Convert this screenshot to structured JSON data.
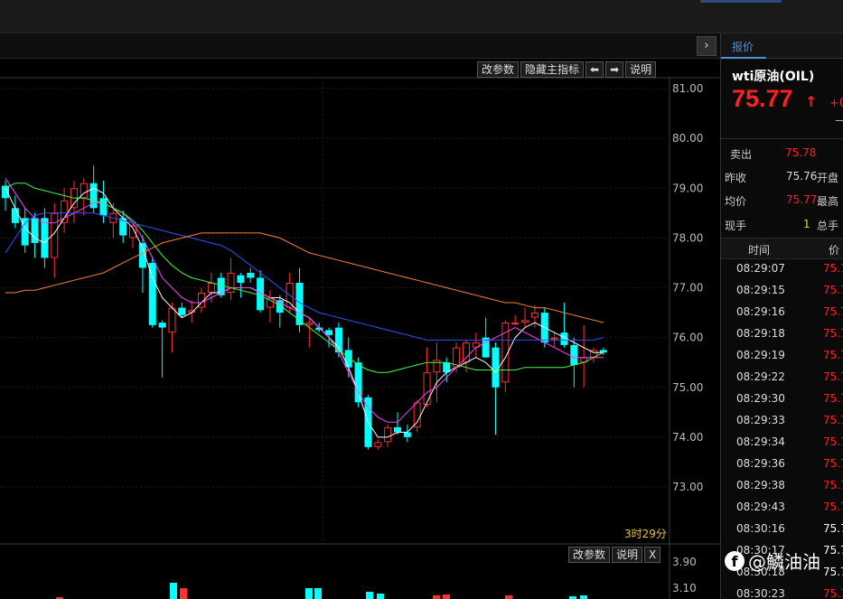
{
  "toolbar": {
    "change_params": "改参数",
    "hide_main_indicator": "隐藏主指标",
    "left_arrow": "⬅",
    "right_arrow": "➡",
    "explain": "说明",
    "collapse_icon": "›"
  },
  "volume_toolbar": {
    "change_params": "改参数",
    "explain": "说明",
    "close": "X"
  },
  "chart_data": {
    "type": "candlestick",
    "ylim": [
      72.0,
      81.2
    ],
    "y_ticks": [
      "81.00",
      "80.00",
      "79.00",
      "78.00",
      "77.00",
      "76.00",
      "75.00",
      "74.00",
      "73.00"
    ],
    "candles": [
      {
        "o": 79.05,
        "h": 79.15,
        "l": 78.55,
        "c": 78.8
      },
      {
        "o": 78.6,
        "h": 78.85,
        "l": 78.2,
        "c": 78.3
      },
      {
        "o": 78.4,
        "h": 78.6,
        "l": 77.7,
        "c": 77.85
      },
      {
        "o": 78.4,
        "h": 78.5,
        "l": 77.6,
        "c": 77.9
      },
      {
        "o": 78.4,
        "h": 78.6,
        "l": 77.4,
        "c": 77.6
      },
      {
        "o": 77.6,
        "h": 78.7,
        "l": 77.2,
        "c": 78.5
      },
      {
        "o": 78.3,
        "h": 79.0,
        "l": 78.1,
        "c": 78.75
      },
      {
        "o": 78.6,
        "h": 79.15,
        "l": 78.3,
        "c": 79.0
      },
      {
        "o": 78.8,
        "h": 79.2,
        "l": 78.45,
        "c": 79.1
      },
      {
        "o": 79.1,
        "h": 79.45,
        "l": 78.5,
        "c": 78.6
      },
      {
        "o": 78.8,
        "h": 79.15,
        "l": 78.3,
        "c": 78.45
      },
      {
        "o": 78.3,
        "h": 78.7,
        "l": 78.0,
        "c": 78.5
      },
      {
        "o": 78.4,
        "h": 78.55,
        "l": 77.9,
        "c": 78.05
      },
      {
        "o": 78.0,
        "h": 78.3,
        "l": 77.8,
        "c": 78.25
      },
      {
        "o": 77.9,
        "h": 78.05,
        "l": 76.9,
        "c": 77.4
      },
      {
        "o": 77.5,
        "h": 77.6,
        "l": 76.2,
        "c": 76.25
      },
      {
        "o": 76.3,
        "h": 76.35,
        "l": 75.2,
        "c": 76.2
      },
      {
        "o": 76.1,
        "h": 76.7,
        "l": 75.7,
        "c": 76.6
      },
      {
        "o": 76.6,
        "h": 76.7,
        "l": 76.4,
        "c": 76.45
      },
      {
        "o": 76.5,
        "h": 76.75,
        "l": 76.3,
        "c": 76.55
      },
      {
        "o": 76.6,
        "h": 77.0,
        "l": 76.5,
        "c": 76.9
      },
      {
        "o": 76.9,
        "h": 77.3,
        "l": 76.7,
        "c": 77.1
      },
      {
        "o": 77.2,
        "h": 77.3,
        "l": 76.8,
        "c": 76.85
      },
      {
        "o": 76.9,
        "h": 77.6,
        "l": 76.75,
        "c": 77.3
      },
      {
        "o": 77.25,
        "h": 77.3,
        "l": 76.8,
        "c": 77.1
      },
      {
        "o": 77.3,
        "h": 77.4,
        "l": 77.1,
        "c": 77.2
      },
      {
        "o": 77.2,
        "h": 77.35,
        "l": 76.5,
        "c": 76.55
      },
      {
        "o": 76.6,
        "h": 76.95,
        "l": 76.3,
        "c": 76.8
      },
      {
        "o": 76.75,
        "h": 76.85,
        "l": 76.2,
        "c": 76.5
      },
      {
        "o": 76.6,
        "h": 77.3,
        "l": 76.5,
        "c": 77.1
      },
      {
        "o": 77.1,
        "h": 77.4,
        "l": 76.1,
        "c": 76.25
      },
      {
        "o": 76.25,
        "h": 76.4,
        "l": 75.8,
        "c": 76.3
      },
      {
        "o": 76.2,
        "h": 76.3,
        "l": 76.1,
        "c": 76.15
      },
      {
        "o": 76.15,
        "h": 76.2,
        "l": 75.8,
        "c": 76.05
      },
      {
        "o": 76.2,
        "h": 76.3,
        "l": 75.6,
        "c": 75.7
      },
      {
        "o": 75.75,
        "h": 76.0,
        "l": 75.2,
        "c": 75.4
      },
      {
        "o": 75.5,
        "h": 75.6,
        "l": 74.6,
        "c": 74.7
      },
      {
        "o": 74.8,
        "h": 74.85,
        "l": 73.75,
        "c": 73.8
      },
      {
        "o": 73.8,
        "h": 73.95,
        "l": 73.75,
        "c": 73.9
      },
      {
        "o": 73.9,
        "h": 74.25,
        "l": 73.8,
        "c": 74.2
      },
      {
        "o": 74.2,
        "h": 74.5,
        "l": 74.05,
        "c": 74.1
      },
      {
        "o": 74.1,
        "h": 74.25,
        "l": 73.9,
        "c": 74.0
      },
      {
        "o": 74.2,
        "h": 74.75,
        "l": 74.1,
        "c": 74.7
      },
      {
        "o": 74.65,
        "h": 75.8,
        "l": 74.6,
        "c": 75.3
      },
      {
        "o": 75.3,
        "h": 75.9,
        "l": 74.7,
        "c": 75.55
      },
      {
        "o": 75.5,
        "h": 75.6,
        "l": 75.1,
        "c": 75.3
      },
      {
        "o": 75.4,
        "h": 75.9,
        "l": 75.3,
        "c": 75.8
      },
      {
        "o": 75.5,
        "h": 75.95,
        "l": 75.3,
        "c": 75.9
      },
      {
        "o": 75.8,
        "h": 76.1,
        "l": 75.6,
        "c": 75.9
      },
      {
        "o": 76.0,
        "h": 76.4,
        "l": 75.6,
        "c": 75.6
      },
      {
        "o": 75.8,
        "h": 75.9,
        "l": 74.05,
        "c": 75.0
      },
      {
        "o": 75.1,
        "h": 76.35,
        "l": 74.9,
        "c": 76.3
      },
      {
        "o": 76.3,
        "h": 76.45,
        "l": 76.25,
        "c": 76.3
      },
      {
        "o": 76.3,
        "h": 76.6,
        "l": 76.2,
        "c": 76.35
      },
      {
        "o": 76.4,
        "h": 76.65,
        "l": 76.2,
        "c": 76.5
      },
      {
        "o": 76.5,
        "h": 76.6,
        "l": 75.8,
        "c": 75.9
      },
      {
        "o": 76.0,
        "h": 76.1,
        "l": 75.8,
        "c": 76.0
      },
      {
        "o": 76.1,
        "h": 76.7,
        "l": 75.8,
        "c": 75.85
      },
      {
        "o": 75.85,
        "h": 76.0,
        "l": 75.0,
        "c": 75.45
      },
      {
        "o": 75.5,
        "h": 76.25,
        "l": 75.0,
        "c": 75.6
      },
      {
        "o": 75.6,
        "h": 75.8,
        "l": 75.5,
        "c": 75.75
      },
      {
        "o": 75.75,
        "h": 75.8,
        "l": 75.65,
        "c": 75.7
      }
    ],
    "lines": [
      {
        "name": "",
        "color": "#ffffff",
        "points": [
          79.0,
          78.6,
          78.2,
          78.0,
          77.9,
          78.1,
          78.4,
          78.7,
          78.9,
          79.0,
          78.9,
          78.6,
          78.4,
          78.2,
          77.8,
          77.2,
          76.8,
          76.6,
          76.4,
          76.5,
          76.7,
          76.9,
          76.9,
          77.0,
          77.0,
          77.0,
          76.9,
          76.8,
          76.8,
          76.7,
          76.5,
          76.4,
          76.2,
          76.0,
          75.8,
          75.4,
          74.9,
          74.3,
          74.0,
          74.0,
          74.1,
          74.1,
          74.3,
          74.7,
          75.1,
          75.3,
          75.4,
          75.5,
          75.6,
          75.5,
          75.3,
          75.6,
          76.0,
          76.2,
          76.3,
          76.2,
          76.1,
          76.0,
          75.9,
          75.8,
          75.7,
          75.7
        ]
      },
      {
        "name": "",
        "color": "#ff40ff",
        "points": [
          79.2,
          78.9,
          78.6,
          78.4,
          78.3,
          78.3,
          78.4,
          78.5,
          78.6,
          78.7,
          78.7,
          78.6,
          78.5,
          78.3,
          78.0,
          77.6,
          77.2,
          77.0,
          76.8,
          76.7,
          76.7,
          76.8,
          76.9,
          77.0,
          77.0,
          77.0,
          76.9,
          76.8,
          76.7,
          76.6,
          76.5,
          76.4,
          76.2,
          76.0,
          75.7,
          75.3,
          74.9,
          74.6,
          74.4,
          74.3,
          74.3,
          74.5,
          74.7,
          74.9,
          75.0,
          75.2,
          75.4,
          75.6,
          75.8,
          75.9,
          76.0,
          76.1,
          76.2,
          76.1,
          76.0,
          75.9,
          75.8,
          75.7,
          75.6,
          75.6,
          75.6,
          75.6
        ]
      },
      {
        "name": "",
        "color": "#40ff40",
        "points": [
          79.0,
          79.1,
          79.1,
          79.0,
          78.95,
          78.9,
          78.85,
          78.8,
          78.8,
          78.75,
          78.7,
          78.6,
          78.5,
          78.35,
          78.15,
          77.9,
          77.65,
          77.45,
          77.3,
          77.2,
          77.15,
          77.1,
          77.05,
          77.0,
          76.95,
          76.9,
          76.85,
          76.75,
          76.65,
          76.5,
          76.35,
          76.2,
          76.05,
          75.9,
          75.75,
          75.6,
          75.45,
          75.35,
          75.3,
          75.3,
          75.35,
          75.4,
          75.45,
          75.5,
          75.5,
          75.5,
          75.45,
          75.4,
          75.35,
          75.35,
          75.35,
          75.35,
          75.35,
          75.4,
          75.4,
          75.4,
          75.4,
          75.4,
          75.45,
          75.5,
          75.6,
          75.7
        ]
      },
      {
        "name": "",
        "color": "#3050ff",
        "points": [
          77.7,
          78.0,
          78.3,
          78.45,
          78.5,
          78.5,
          78.5,
          78.5,
          78.5,
          78.5,
          78.45,
          78.4,
          78.35,
          78.3,
          78.25,
          78.2,
          78.15,
          78.1,
          78.05,
          78.0,
          77.95,
          77.9,
          77.85,
          77.75,
          77.6,
          77.45,
          77.3,
          77.15,
          77.0,
          76.85,
          76.7,
          76.6,
          76.5,
          76.45,
          76.4,
          76.35,
          76.3,
          76.25,
          76.2,
          76.15,
          76.1,
          76.05,
          76.0,
          75.95,
          75.95,
          75.95,
          75.95,
          75.95,
          75.95,
          75.95,
          75.95,
          75.95,
          75.95,
          75.95,
          75.95,
          75.95,
          75.95,
          75.95,
          75.95,
          75.95,
          75.95,
          76.0
        ]
      },
      {
        "name": "",
        "color": "#ff8030",
        "points": [
          76.9,
          76.9,
          76.95,
          76.95,
          77.0,
          77.05,
          77.1,
          77.15,
          77.2,
          77.25,
          77.3,
          77.4,
          77.5,
          77.6,
          77.7,
          77.8,
          77.9,
          77.95,
          78.0,
          78.05,
          78.1,
          78.1,
          78.1,
          78.1,
          78.1,
          78.1,
          78.1,
          78.05,
          78.0,
          77.9,
          77.8,
          77.7,
          77.65,
          77.6,
          77.55,
          77.5,
          77.45,
          77.4,
          77.35,
          77.3,
          77.25,
          77.2,
          77.15,
          77.1,
          77.05,
          77.0,
          76.95,
          76.9,
          76.85,
          76.8,
          76.75,
          76.7,
          76.7,
          76.65,
          76.6,
          76.6,
          76.55,
          76.5,
          76.45,
          76.4,
          76.35,
          76.3
        ]
      }
    ],
    "volume_ticks": [
      "3.90",
      "3.10"
    ]
  },
  "timer_text": "3时29分",
  "panel": {
    "tab_label": "报价",
    "symbol": "wti原油(OIL)",
    "price": "75.77",
    "change": "+0",
    "sell_label": "卖出",
    "sell_value": "75.78",
    "prev_close_label": "昨收",
    "prev_close_value": "75.76",
    "open_label": "开盘",
    "avg_label": "均价",
    "avg_value": "75.77",
    "high_label": "最高",
    "current_hand_label": "现手",
    "current_hand_value": "1",
    "total_hand_label": "总手",
    "time_header": "时间",
    "price_header": "价",
    "trades": [
      {
        "time": "08:29:07",
        "price": "75.7",
        "color": "#ff2020"
      },
      {
        "time": "08:29:15",
        "price": "75.7",
        "color": "#ff2020"
      },
      {
        "time": "08:29:16",
        "price": "75.7",
        "color": "#ff2020"
      },
      {
        "time": "08:29:18",
        "price": "75.7",
        "color": "#ff2020"
      },
      {
        "time": "08:29:19",
        "price": "75.7",
        "color": "#ff2020"
      },
      {
        "time": "08:29:22",
        "price": "75.7",
        "color": "#ff2020"
      },
      {
        "time": "08:29:30",
        "price": "75.7",
        "color": "#ff2020"
      },
      {
        "time": "08:29:33",
        "price": "75.7",
        "color": "#ff2020"
      },
      {
        "time": "08:29:34",
        "price": "75.7",
        "color": "#ff2020"
      },
      {
        "time": "08:29:36",
        "price": "75.7",
        "color": "#ff2020"
      },
      {
        "time": "08:29:38",
        "price": "75.7",
        "color": "#ff2020"
      },
      {
        "time": "08:29:43",
        "price": "75.7",
        "color": "#ff2020"
      },
      {
        "time": "08:30:16",
        "price": "75.7",
        "color": "#ffffff"
      },
      {
        "time": "08:30:17",
        "price": "75.7",
        "color": "#ffffff"
      },
      {
        "time": "08:30:18",
        "price": "75.7",
        "color": "#ffffff"
      },
      {
        "time": "08:30:23",
        "price": "75.7",
        "color": "#ff2020"
      }
    ]
  },
  "watermark": "@鱗油油"
}
